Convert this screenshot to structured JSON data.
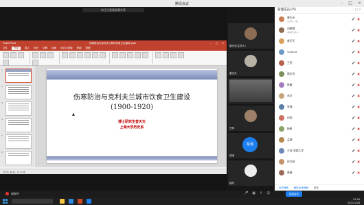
{
  "meeting": {
    "title": "腾讯会议",
    "share_banner": "你正在观看屏幕共享",
    "speaker_label": "正在讲话: 曾天天"
  },
  "ppt": {
    "app_name": "PowerPoint",
    "doc_name": "伤寒防治与克利夫兰城市饮食卫生建设.pptx",
    "tabs": [
      "文件",
      "开始",
      "插入",
      "设计",
      "切换",
      "动画",
      "幻灯片放映",
      "审阅",
      "视图"
    ],
    "active_tab": "开始",
    "status_text": "幻灯片 第1张，共 24 张",
    "slide": {
      "title_line1": "伤寒防治与克利夫兰城市饮食卫生建设",
      "title_line2": "(1900-1920)",
      "author": "博士研究生曾天天",
      "affiliation": "上海大学历史系"
    },
    "thumb_numbers": [
      "1",
      "2",
      "3",
      "4",
      "5",
      "6"
    ]
  },
  "video_tiles": [
    {
      "name": "曾天天(主持人)"
    },
    {
      "name": "曾天天"
    },
    {
      "name": ""
    },
    {
      "name": "王明"
    },
    {
      "name": "成涛",
      "badge": "陈涛"
    },
    {
      "name": "赵阳"
    }
  ],
  "participants": {
    "header": "管理成员(25)",
    "list": [
      {
        "name": "曾天天",
        "sub": "(主持人, 我)"
      },
      {
        "name": "刘晓霞",
        "sub": "(联席主持人)"
      },
      {
        "name": "曾天天",
        "sub": ""
      },
      {
        "name": "Victoria",
        "sub": ""
      },
      {
        "name": "王亮",
        "sub": ""
      },
      {
        "name": "周文杰",
        "sub": ""
      },
      {
        "name": "陈敏",
        "sub": ""
      },
      {
        "name": "李华",
        "sub": ""
      },
      {
        "name": "张强",
        "sub": ""
      },
      {
        "name": "何欣",
        "sub": ""
      },
      {
        "name": "杨帆",
        "sub": ""
      },
      {
        "name": "孟婷",
        "sub": ""
      },
      {
        "name": "王涛 鸿鹄大学",
        "sub": ""
      },
      {
        "name": "孙文斌",
        "sub": ""
      },
      {
        "name": "林琳",
        "sub": ""
      }
    ],
    "footer": [
      "全员静音",
      "解除全体静音",
      "更多"
    ]
  },
  "toolbar": {
    "recording": "录制中",
    "end_label": "结束会议"
  },
  "taskbar": {
    "time": "15:26",
    "date": "2021/1/28"
  }
}
